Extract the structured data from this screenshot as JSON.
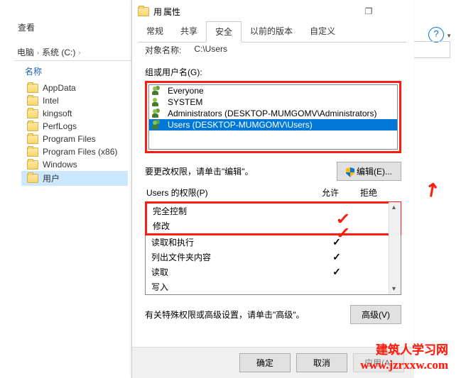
{
  "explorer": {
    "view_label": "查看",
    "address": {
      "crumb1": "电脑",
      "crumb2": "系统 (C:)"
    },
    "nav_header": "名称",
    "folders": [
      "AppData",
      "Intel",
      "kingsoft",
      "PerfLogs",
      "Program Files",
      "Program Files (x86)",
      "Windows",
      "用户"
    ]
  },
  "dialog": {
    "title_prefix": "用",
    "title_rest": "属性",
    "restore_square": "❐",
    "tabs": [
      "常规",
      "共享",
      "安全",
      "以前的版本",
      "自定义"
    ],
    "object_label": "对象名称:",
    "object_value": "C:\\Users",
    "group_label": "组或用户名(G):",
    "groups": [
      {
        "icon": "multi",
        "text": "Everyone"
      },
      {
        "icon": "single",
        "text": "SYSTEM"
      },
      {
        "icon": "multi",
        "text": "Administrators (DESKTOP-MUMGOMV\\Administrators)"
      },
      {
        "icon": "multi",
        "text": "Users (DESKTOP-MUMGOMV\\Users)"
      }
    ],
    "edit_hint": "要更改权限，请单击\"编辑\"。",
    "edit_btn": "编辑(E)...",
    "perm_title_prefix": "Users 的权限(P)",
    "perm_allow": "允许",
    "perm_deny": "拒绝",
    "perms": [
      {
        "name": "完全控制",
        "allow": false,
        "highlight": true
      },
      {
        "name": "修改",
        "allow": false,
        "highlight": true
      },
      {
        "name": "读取和执行",
        "allow": true,
        "highlight": false
      },
      {
        "name": "列出文件夹内容",
        "allow": true,
        "highlight": false
      },
      {
        "name": "读取",
        "allow": true,
        "highlight": false
      },
      {
        "name": "写入",
        "allow": false,
        "highlight": false
      }
    ],
    "adv_hint": "有关特殊权限或高级设置，请单击\"高级\"。",
    "adv_btn": "高级(V)",
    "ok": "确定",
    "cancel": "取消",
    "apply": "应用(A)"
  },
  "watermark": {
    "line1": "建筑人学习网",
    "line2": "www.jzrxxw.com"
  }
}
